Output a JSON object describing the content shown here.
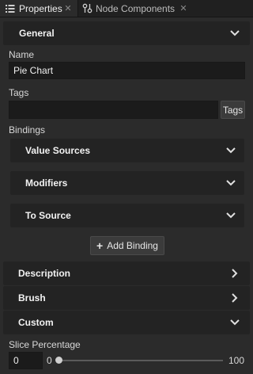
{
  "tabs": [
    {
      "label": "Properties",
      "icon": "list-icon",
      "active": true
    },
    {
      "label": "Node Components",
      "icon": "node-components-icon",
      "active": false
    }
  ],
  "sections": {
    "general": "General",
    "description": "Description",
    "brush": "Brush",
    "custom": "Custom"
  },
  "general": {
    "name_label": "Name",
    "name_value": "Pie Chart",
    "tags_label": "Tags",
    "tags_value": "",
    "tags_button": "Tags",
    "bindings_label": "Bindings",
    "bindings_items": [
      "Value Sources",
      "Modifiers",
      "To Source"
    ],
    "add_binding": "Add Binding"
  },
  "custom": {
    "slice_label": "Slice Percentage",
    "slice_value": "0",
    "slider_min": "0",
    "slider_max": "100",
    "slider_level": 0
  },
  "colors": {
    "background": "#2b2b2b",
    "header": "#232323",
    "input": "#1b1b1b"
  }
}
